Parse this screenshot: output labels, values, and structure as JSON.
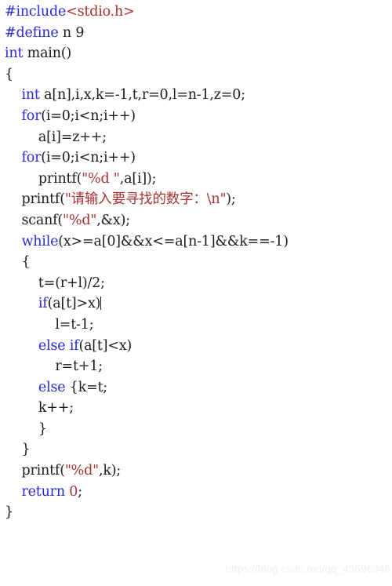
{
  "editor": {
    "language": "C",
    "background_color": "#ffffff",
    "keyword_color": "#2b2bd4",
    "string_color": "#a63232",
    "plain_color": "#1c1c1c",
    "caret_after_line_index": 17,
    "lines": [
      {
        "indent": 0,
        "tokens": [
          {
            "t": "kw",
            "v": "#include"
          },
          {
            "t": "str",
            "v": "<stdio.h>"
          }
        ]
      },
      {
        "indent": 0,
        "tokens": [
          {
            "t": "kw",
            "v": "#define"
          },
          {
            "t": "pln",
            "v": " n 9"
          }
        ]
      },
      {
        "indent": 0,
        "tokens": [
          {
            "t": "kw",
            "v": "int"
          },
          {
            "t": "pln",
            "v": " main()"
          }
        ]
      },
      {
        "indent": 0,
        "tokens": [
          {
            "t": "pln",
            "v": "{"
          }
        ]
      },
      {
        "indent": 4,
        "tokens": [
          {
            "t": "kw",
            "v": "int"
          },
          {
            "t": "pln",
            "v": " a[n],i,x,k=-1,t,r=0,l=n-1,z=0;"
          }
        ]
      },
      {
        "indent": 4,
        "tokens": [
          {
            "t": "kw",
            "v": "for"
          },
          {
            "t": "pln",
            "v": "(i=0;i<n;i++)"
          }
        ]
      },
      {
        "indent": 8,
        "tokens": [
          {
            "t": "pln",
            "v": "a[i]=z++;"
          }
        ]
      },
      {
        "indent": 4,
        "tokens": [
          {
            "t": "kw",
            "v": "for"
          },
          {
            "t": "pln",
            "v": "(i=0;i<n;i++)"
          }
        ]
      },
      {
        "indent": 8,
        "tokens": [
          {
            "t": "pln",
            "v": "printf("
          },
          {
            "t": "str",
            "v": "\"%d \""
          },
          {
            "t": "pln",
            "v": ",a[i]);"
          }
        ]
      },
      {
        "indent": 4,
        "tokens": [
          {
            "t": "pln",
            "v": "printf("
          },
          {
            "t": "str",
            "v": "\"请输入要寻找的数字：\\n\""
          },
          {
            "t": "pln",
            "v": ");"
          }
        ]
      },
      {
        "indent": 4,
        "tokens": [
          {
            "t": "pln",
            "v": "scanf("
          },
          {
            "t": "str",
            "v": "\"%d\""
          },
          {
            "t": "pln",
            "v": ",&x);"
          }
        ]
      },
      {
        "indent": 4,
        "tokens": [
          {
            "t": "kw",
            "v": "while"
          },
          {
            "t": "pln",
            "v": "(x>=a[0]&&x<=a[n-1]&&k==-1)"
          }
        ]
      },
      {
        "indent": 4,
        "tokens": [
          {
            "t": "pln",
            "v": "{"
          }
        ]
      },
      {
        "indent": 8,
        "tokens": [
          {
            "t": "pln",
            "v": "t=(r+l)/2;"
          }
        ]
      },
      {
        "indent": 8,
        "tokens": [
          {
            "t": "kw",
            "v": "if"
          },
          {
            "t": "pln",
            "v": "(a[t]>x)"
          }
        ]
      },
      {
        "indent": 12,
        "tokens": [
          {
            "t": "pln",
            "v": "l=t-1;"
          }
        ]
      },
      {
        "indent": 8,
        "tokens": [
          {
            "t": "kw",
            "v": "else if"
          },
          {
            "t": "pln",
            "v": "(a[t]<x)"
          }
        ]
      },
      {
        "indent": 12,
        "tokens": [
          {
            "t": "pln",
            "v": "r=t+1;"
          }
        ]
      },
      {
        "indent": 8,
        "tokens": [
          {
            "t": "kw",
            "v": "else"
          },
          {
            "t": "pln",
            "v": " {k=t;"
          }
        ]
      },
      {
        "indent": 8,
        "tokens": [
          {
            "t": "pln",
            "v": "k++;"
          }
        ]
      },
      {
        "indent": 8,
        "tokens": [
          {
            "t": "pln",
            "v": "}"
          }
        ]
      },
      {
        "indent": 4,
        "tokens": [
          {
            "t": "pln",
            "v": "}"
          }
        ]
      },
      {
        "indent": 4,
        "tokens": [
          {
            "t": "pln",
            "v": "printf("
          },
          {
            "t": "str",
            "v": "\"%d\""
          },
          {
            "t": "pln",
            "v": ",k);"
          }
        ]
      },
      {
        "indent": 4,
        "tokens": [
          {
            "t": "kw",
            "v": "return"
          },
          {
            "t": "str",
            "v": " 0"
          },
          {
            "t": "pln",
            "v": ";"
          }
        ]
      },
      {
        "indent": 0,
        "tokens": [
          {
            "t": "pln",
            "v": "}"
          }
        ]
      }
    ]
  },
  "watermark": {
    "text": "https://blog.csdn.net/qq_43596946",
    "color": "#f0f0f0"
  }
}
